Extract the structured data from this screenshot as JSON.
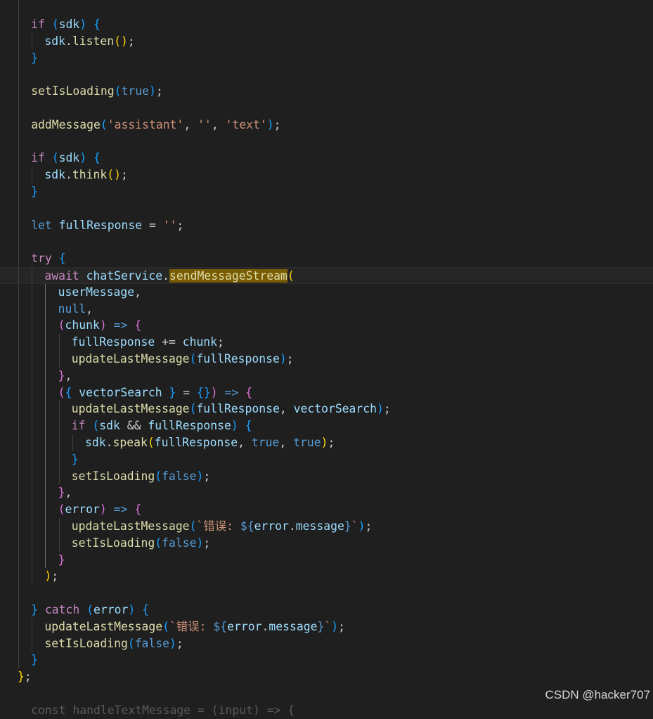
{
  "editor": {
    "current_line": 16,
    "lines": [
      {
        "i": 1,
        "t": [
          [
            "ctl",
            "if"
          ],
          [
            "punc",
            " "
          ],
          [
            "p3",
            "("
          ],
          [
            "var",
            "sdk"
          ],
          [
            "p3",
            ")"
          ],
          [
            "punc",
            " "
          ],
          [
            "p3",
            "{"
          ]
        ]
      },
      {
        "i": 2,
        "t": [
          [
            "var",
            "sdk"
          ],
          [
            "punc",
            "."
          ],
          [
            "fn",
            "listen"
          ],
          [
            "p1",
            "()"
          ],
          [
            "punc",
            ";"
          ]
        ]
      },
      {
        "i": 1,
        "t": [
          [
            "p3",
            "}"
          ]
        ]
      },
      {
        "i": 1,
        "t": []
      },
      {
        "i": 1,
        "t": [
          [
            "fn",
            "setIsLoading"
          ],
          [
            "p3",
            "("
          ],
          [
            "kw",
            "true"
          ],
          [
            "p3",
            ")"
          ],
          [
            "punc",
            ";"
          ]
        ]
      },
      {
        "i": 1,
        "t": []
      },
      {
        "i": 1,
        "t": [
          [
            "fn",
            "addMessage"
          ],
          [
            "p3",
            "("
          ],
          [
            "str",
            "'assistant'"
          ],
          [
            "punc",
            ", "
          ],
          [
            "str",
            "''"
          ],
          [
            "punc",
            ", "
          ],
          [
            "str",
            "'text'"
          ],
          [
            "p3",
            ")"
          ],
          [
            "punc",
            ";"
          ]
        ]
      },
      {
        "i": 1,
        "t": []
      },
      {
        "i": 1,
        "t": [
          [
            "ctl",
            "if"
          ],
          [
            "punc",
            " "
          ],
          [
            "p3",
            "("
          ],
          [
            "var",
            "sdk"
          ],
          [
            "p3",
            ")"
          ],
          [
            "punc",
            " "
          ],
          [
            "p3",
            "{"
          ]
        ]
      },
      {
        "i": 2,
        "t": [
          [
            "var",
            "sdk"
          ],
          [
            "punc",
            "."
          ],
          [
            "fn",
            "think"
          ],
          [
            "p1",
            "()"
          ],
          [
            "punc",
            ";"
          ]
        ]
      },
      {
        "i": 1,
        "t": [
          [
            "p3",
            "}"
          ]
        ]
      },
      {
        "i": 1,
        "t": []
      },
      {
        "i": 1,
        "t": [
          [
            "kw",
            "let"
          ],
          [
            "punc",
            " "
          ],
          [
            "var",
            "fullResponse"
          ],
          [
            "punc",
            " = "
          ],
          [
            "str",
            "''"
          ],
          [
            "punc",
            ";"
          ]
        ]
      },
      {
        "i": 1,
        "t": []
      },
      {
        "i": 1,
        "t": [
          [
            "ctl",
            "try"
          ],
          [
            "punc",
            " "
          ],
          [
            "p3",
            "{"
          ]
        ]
      },
      {
        "i": 2,
        "t": [
          [
            "ctl",
            "await"
          ],
          [
            "punc",
            " "
          ],
          [
            "var",
            "chatService"
          ],
          [
            "punc",
            "."
          ],
          [
            "hl",
            "sendMessageStream"
          ],
          [
            "p1",
            "("
          ]
        ]
      },
      {
        "i": 3,
        "t": [
          [
            "var",
            "userMessage"
          ],
          [
            "punc",
            ","
          ]
        ]
      },
      {
        "i": 3,
        "t": [
          [
            "kw",
            "null"
          ],
          [
            "punc",
            ","
          ]
        ]
      },
      {
        "i": 3,
        "t": [
          [
            "p2",
            "("
          ],
          [
            "var",
            "chunk"
          ],
          [
            "p2",
            ")"
          ],
          [
            "punc",
            " "
          ],
          [
            "kw",
            "=>"
          ],
          [
            "punc",
            " "
          ],
          [
            "p2",
            "{"
          ]
        ]
      },
      {
        "i": 4,
        "t": [
          [
            "var",
            "fullResponse"
          ],
          [
            "punc",
            " += "
          ],
          [
            "var",
            "chunk"
          ],
          [
            "punc",
            ";"
          ]
        ]
      },
      {
        "i": 4,
        "t": [
          [
            "fn",
            "updateLastMessage"
          ],
          [
            "p3",
            "("
          ],
          [
            "var",
            "fullResponse"
          ],
          [
            "p3",
            ")"
          ],
          [
            "punc",
            ";"
          ]
        ]
      },
      {
        "i": 3,
        "t": [
          [
            "p2",
            "}"
          ],
          [
            "punc",
            ","
          ]
        ]
      },
      {
        "i": 3,
        "t": [
          [
            "p2",
            "("
          ],
          [
            "p3",
            "{"
          ],
          [
            "punc",
            " "
          ],
          [
            "var",
            "vectorSearch"
          ],
          [
            "punc",
            " "
          ],
          [
            "p3",
            "}"
          ],
          [
            "punc",
            " = "
          ],
          [
            "p3",
            "{}"
          ],
          [
            "p2",
            ")"
          ],
          [
            "punc",
            " "
          ],
          [
            "kw",
            "=>"
          ],
          [
            "punc",
            " "
          ],
          [
            "p2",
            "{"
          ]
        ]
      },
      {
        "i": 4,
        "t": [
          [
            "fn",
            "updateLastMessage"
          ],
          [
            "p3",
            "("
          ],
          [
            "var",
            "fullResponse"
          ],
          [
            "punc",
            ", "
          ],
          [
            "var",
            "vectorSearch"
          ],
          [
            "p3",
            ")"
          ],
          [
            "punc",
            ";"
          ]
        ]
      },
      {
        "i": 4,
        "t": [
          [
            "ctl",
            "if"
          ],
          [
            "punc",
            " "
          ],
          [
            "p3",
            "("
          ],
          [
            "var",
            "sdk"
          ],
          [
            "punc",
            " && "
          ],
          [
            "var",
            "fullResponse"
          ],
          [
            "p3",
            ")"
          ],
          [
            "punc",
            " "
          ],
          [
            "p3",
            "{"
          ]
        ]
      },
      {
        "i": 5,
        "t": [
          [
            "var",
            "sdk"
          ],
          [
            "punc",
            "."
          ],
          [
            "fn",
            "speak"
          ],
          [
            "p1",
            "("
          ],
          [
            "var",
            "fullResponse"
          ],
          [
            "punc",
            ", "
          ],
          [
            "kw",
            "true"
          ],
          [
            "punc",
            ", "
          ],
          [
            "kw",
            "true"
          ],
          [
            "p1",
            ")"
          ],
          [
            "punc",
            ";"
          ]
        ]
      },
      {
        "i": 4,
        "t": [
          [
            "p3",
            "}"
          ]
        ]
      },
      {
        "i": 4,
        "t": [
          [
            "fn",
            "setIsLoading"
          ],
          [
            "p3",
            "("
          ],
          [
            "kw",
            "false"
          ],
          [
            "p3",
            ")"
          ],
          [
            "punc",
            ";"
          ]
        ]
      },
      {
        "i": 3,
        "t": [
          [
            "p2",
            "}"
          ],
          [
            "punc",
            ","
          ]
        ]
      },
      {
        "i": 3,
        "t": [
          [
            "p2",
            "("
          ],
          [
            "var",
            "error"
          ],
          [
            "p2",
            ")"
          ],
          [
            "punc",
            " "
          ],
          [
            "kw",
            "=>"
          ],
          [
            "punc",
            " "
          ],
          [
            "p2",
            "{"
          ]
        ]
      },
      {
        "i": 4,
        "t": [
          [
            "fn",
            "updateLastMessage"
          ],
          [
            "p3",
            "("
          ],
          [
            "str",
            "`错误: "
          ],
          [
            "kw",
            "${"
          ],
          [
            "var",
            "error"
          ],
          [
            "punc",
            "."
          ],
          [
            "var",
            "message"
          ],
          [
            "kw",
            "}"
          ],
          [
            "str",
            "`"
          ],
          [
            "p3",
            ")"
          ],
          [
            "punc",
            ";"
          ]
        ]
      },
      {
        "i": 4,
        "t": [
          [
            "fn",
            "setIsLoading"
          ],
          [
            "p3",
            "("
          ],
          [
            "kw",
            "false"
          ],
          [
            "p3",
            ")"
          ],
          [
            "punc",
            ";"
          ]
        ]
      },
      {
        "i": 3,
        "t": [
          [
            "p2",
            "}"
          ]
        ]
      },
      {
        "i": 2,
        "t": [
          [
            "p1",
            ")"
          ],
          [
            "punc",
            ";"
          ]
        ]
      },
      {
        "i": 1,
        "t": []
      },
      {
        "i": 1,
        "t": [
          [
            "p3",
            "}"
          ],
          [
            "punc",
            " "
          ],
          [
            "ctl",
            "catch"
          ],
          [
            "punc",
            " "
          ],
          [
            "p3",
            "("
          ],
          [
            "var",
            "error"
          ],
          [
            "p3",
            ")"
          ],
          [
            "punc",
            " "
          ],
          [
            "p3",
            "{"
          ]
        ]
      },
      {
        "i": 2,
        "t": [
          [
            "fn",
            "updateLastMessage"
          ],
          [
            "p3",
            "("
          ],
          [
            "str",
            "`错误: "
          ],
          [
            "kw",
            "${"
          ],
          [
            "var",
            "error"
          ],
          [
            "punc",
            "."
          ],
          [
            "var",
            "message"
          ],
          [
            "kw",
            "}"
          ],
          [
            "str",
            "`"
          ],
          [
            "p3",
            ")"
          ],
          [
            "punc",
            ";"
          ]
        ]
      },
      {
        "i": 2,
        "t": [
          [
            "fn",
            "setIsLoading"
          ],
          [
            "p3",
            "("
          ],
          [
            "kw",
            "false"
          ],
          [
            "p3",
            ")"
          ],
          [
            "punc",
            ";"
          ]
        ]
      },
      {
        "i": 1,
        "t": [
          [
            "p3",
            "}"
          ]
        ]
      },
      {
        "i": 0,
        "t": [
          [
            "p1",
            "}"
          ],
          [
            "punc",
            ";"
          ]
        ]
      },
      {
        "i": 0,
        "t": []
      },
      {
        "i": 1,
        "t": [
          [
            "tail",
            "const handleTextMessage = (input) => {"
          ]
        ]
      }
    ]
  },
  "watermark": "CSDN @hacker707"
}
